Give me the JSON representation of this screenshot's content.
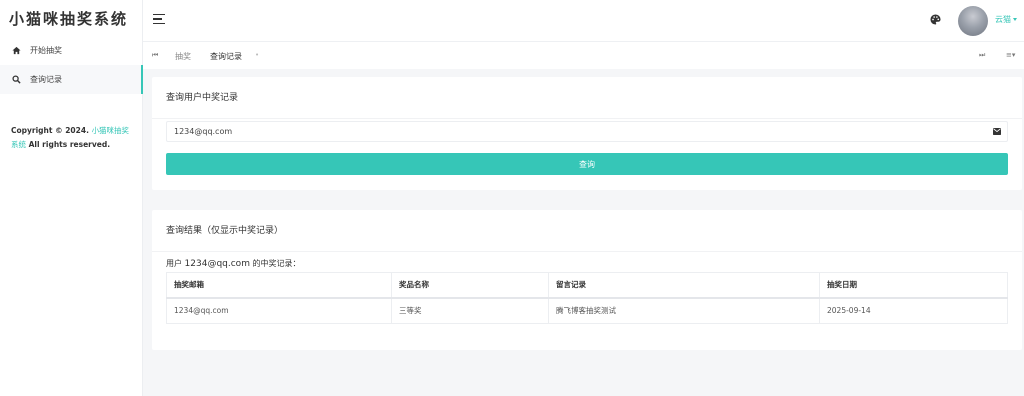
{
  "app": {
    "title": "小猫咪抽奖系统"
  },
  "sidebar": {
    "items": [
      {
        "label": "开始抽奖",
        "icon": "home-icon"
      },
      {
        "label": "查询记录",
        "icon": "search-icon"
      }
    ],
    "copyright_prefix": "Copyright © 2024.",
    "copyright_link": "小猫咪抽奖系统",
    "copyright_suffix": "All rights reserved."
  },
  "header": {
    "username": "云猫"
  },
  "tabs": {
    "items": [
      "抽奖",
      "查询记录"
    ]
  },
  "query_card": {
    "title": "查询用户中奖记录",
    "email_value": "1234@qq.com",
    "button_label": "查询"
  },
  "result_card": {
    "title": "查询结果（仅显示中奖记录）",
    "desc_prefix": "用户",
    "desc_email": "1234@qq.com",
    "desc_suffix": "的中奖记录：",
    "columns": [
      "抽奖邮箱",
      "奖品名称",
      "留言记录",
      "抽奖日期"
    ],
    "rows": [
      [
        "1234@qq.com",
        "三等奖",
        "腾飞博客抽奖测试",
        "2025-09-14"
      ]
    ]
  },
  "colors": {
    "accent": "#36c6b7"
  }
}
